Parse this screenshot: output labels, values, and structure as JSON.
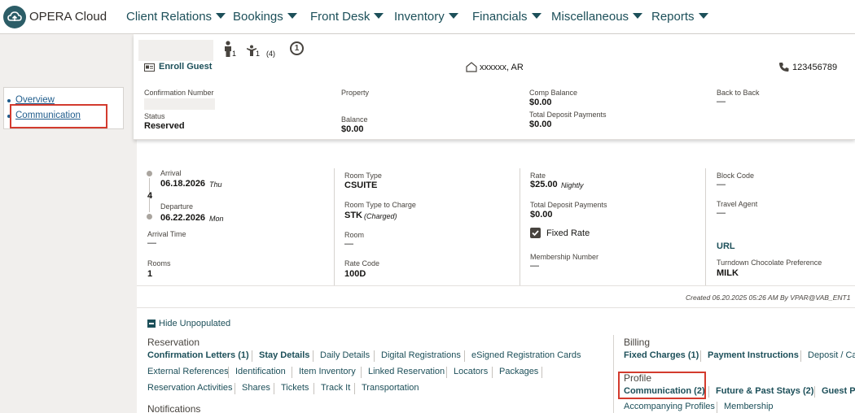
{
  "header": {
    "brand": "OPERA Cloud",
    "nav": [
      "Client Relations",
      "Bookings",
      "Front Desk",
      "Inventory",
      "Financials",
      "Miscellaneous",
      "Reports"
    ]
  },
  "sidebar": {
    "links": [
      "Overview",
      "Communication"
    ]
  },
  "guest": {
    "adults": "1",
    "children": "1",
    "children_extra": "(4)",
    "badge": "1",
    "enroll_label": "Enroll Guest",
    "address": "xxxxxx, AR",
    "phone": "123456789"
  },
  "summary": {
    "confirmation_label": "Confirmation Number",
    "status_label": "Status",
    "status_value": "Reserved",
    "property_label": "Property",
    "balance_label": "Balance",
    "balance_value": "$0.00",
    "comp_label": "Comp Balance",
    "comp_value": "$0.00",
    "deposit_label": "Total Deposit Payments",
    "deposit_value": "$0.00",
    "b2b_label": "Back to Back",
    "b2b_value": "—"
  },
  "details": {
    "arrival_label": "Arrival",
    "arrival_date": "06.18.2026",
    "arrival_day": "Thu",
    "nights": "4",
    "departure_label": "Departure",
    "departure_date": "06.22.2026",
    "departure_day": "Mon",
    "arrival_time_label": "Arrival Time",
    "arrival_time_value": "—",
    "rooms_label": "Rooms",
    "rooms_value": "1",
    "room_type_label": "Room Type",
    "room_type_value": "CSUITE",
    "rtc_label": "Room Type to Charge",
    "rtc_value": "STK",
    "rtc_note": "(Charged)",
    "room_label": "Room",
    "room_value": "—",
    "rate_code_label": "Rate Code",
    "rate_code_value": "100D",
    "rate_label": "Rate",
    "rate_value": "$25.00",
    "rate_note": "Nightly",
    "tdp_label": "Total Deposit Payments",
    "tdp_value": "$0.00",
    "fixed_rate_label": "Fixed Rate",
    "fixed_rate_checked": true,
    "membership_label": "Membership Number",
    "membership_value": "—",
    "block_label": "Block Code",
    "block_value": "—",
    "travel_label": "Travel Agent",
    "travel_value": "—",
    "url_label": "URL",
    "turndown_label": "Turndown Chocolate Preference",
    "turndown_value": "MILK",
    "created": "Created",
    "created_date": "06.20.2025 05:26 AM",
    "created_by": "By",
    "created_user": "VPAR@VAB_ENT1"
  },
  "links": {
    "hide_unpopulated": "Hide Unpopulated",
    "reservation_title": "Reservation",
    "reservation_row1": [
      "Confirmation Letters (1)",
      "Stay Details",
      "Daily Details",
      "Digital Registrations",
      "eSigned Registration Cards"
    ],
    "reservation_row2": [
      "External References",
      "Identification",
      "Item Inventory",
      "Linked Reservation",
      "Locators",
      "Packages"
    ],
    "reservation_row3": [
      "Reservation Activities",
      "Shares",
      "Tickets",
      "Track It",
      "Transportation"
    ],
    "notifications_title": "Notifications",
    "billing_title": "Billing",
    "billing_row": [
      "Fixed Charges (1)",
      "Payment Instructions",
      "Deposit / Ca"
    ],
    "profile_title": "Profile",
    "profile_row1": [
      "Communication (2)",
      "Future & Past Stays (2)",
      "Guest Pr"
    ],
    "profile_row2": [
      "Accompanying Profiles",
      "Membership"
    ]
  },
  "colors": {
    "accent": "#1c4f59",
    "highlight": "#d33b2e"
  }
}
